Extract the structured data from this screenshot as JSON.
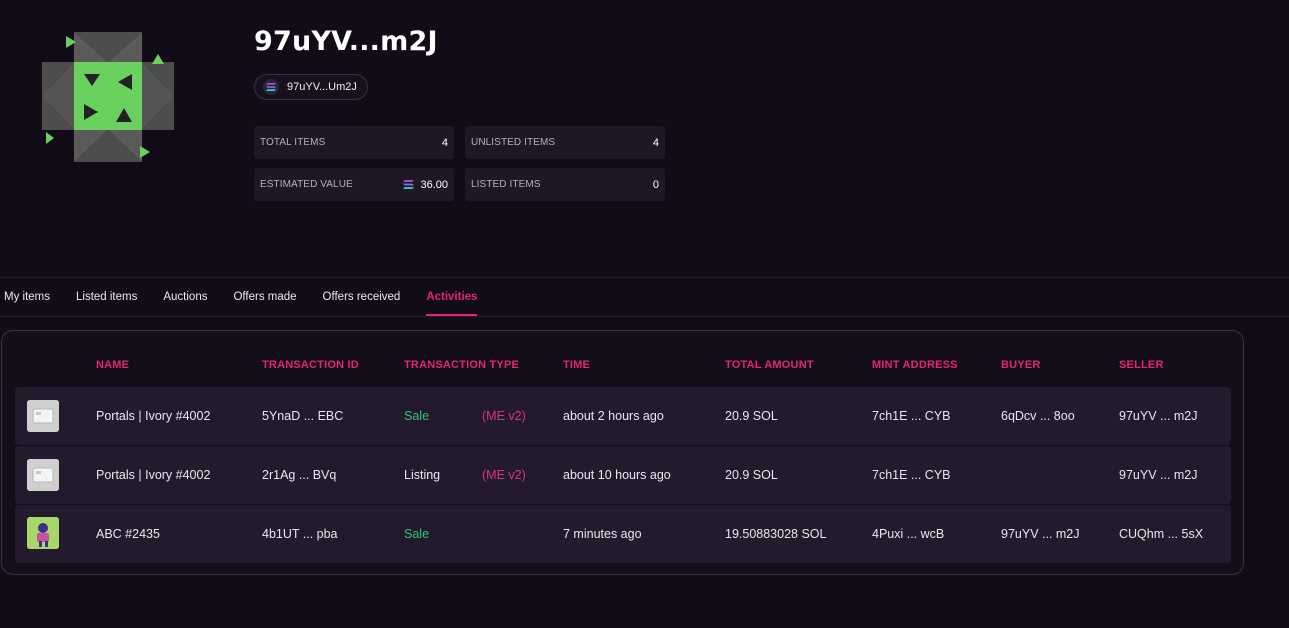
{
  "profile": {
    "title": "97uYV...m2J",
    "address_chip": "97uYV...Um2J"
  },
  "stats": {
    "total_items": {
      "label": "TOTAL ITEMS",
      "value": "4"
    },
    "unlisted_items": {
      "label": "UNLISTED ITEMS",
      "value": "4"
    },
    "estimated_value": {
      "label": "ESTIMATED VALUE",
      "value": "36.00",
      "icon": "solana-icon"
    },
    "listed_items": {
      "label": "LISTED ITEMS",
      "value": "0"
    }
  },
  "tabs": [
    {
      "label": "My items",
      "active": false
    },
    {
      "label": "Listed items",
      "active": false
    },
    {
      "label": "Auctions",
      "active": false
    },
    {
      "label": "Offers made",
      "active": false
    },
    {
      "label": "Offers received",
      "active": false
    },
    {
      "label": "Activities",
      "active": true
    }
  ],
  "table": {
    "headers": [
      "NAME",
      "TRANSACTION ID",
      "TRANSACTION TYPE",
      "TIME",
      "TOTAL AMOUNT",
      "MINT ADDRESS",
      "BUYER",
      "SELLER"
    ],
    "rows": [
      {
        "thumb": "ivory-card-thumb",
        "name": "Portals | Ivory #4002",
        "tx_id": "5YnaD ... EBC",
        "tx_type": "Sale",
        "marketplace": "(ME v2)",
        "time": "about 2 hours ago",
        "amount": "20.9 SOL",
        "mint": "7ch1E ... CYB",
        "buyer": "6qDcv ... 8oo",
        "seller": "97uYV ... m2J"
      },
      {
        "thumb": "ivory-card-thumb",
        "name": "Portals | Ivory #4002",
        "tx_id": "2r1Ag ... BVq",
        "tx_type": "Listing",
        "marketplace": "(ME v2)",
        "time": "about 10 hours ago",
        "amount": "20.9 SOL",
        "mint": "7ch1E ... CYB",
        "buyer": "",
        "seller": "97uYV ... m2J"
      },
      {
        "thumb": "abc-nft-thumb",
        "name": "ABC #2435",
        "tx_id": "4b1UT ... pba",
        "tx_type": "Sale",
        "marketplace": "",
        "time": "7 minutes ago",
        "amount": "19.50883028 SOL",
        "mint": "4Puxi ... wcB",
        "buyer": "97uYV ... m2J",
        "seller": "CUQhm ... 5sX"
      }
    ]
  },
  "colors": {
    "background": "#120c18",
    "accent_pink": "#e42575",
    "sale_green": "#2ec773",
    "row_bg": "#231a2d",
    "avatar_green": "#6ad05e",
    "avatar_gray": "#4a4a4a"
  }
}
